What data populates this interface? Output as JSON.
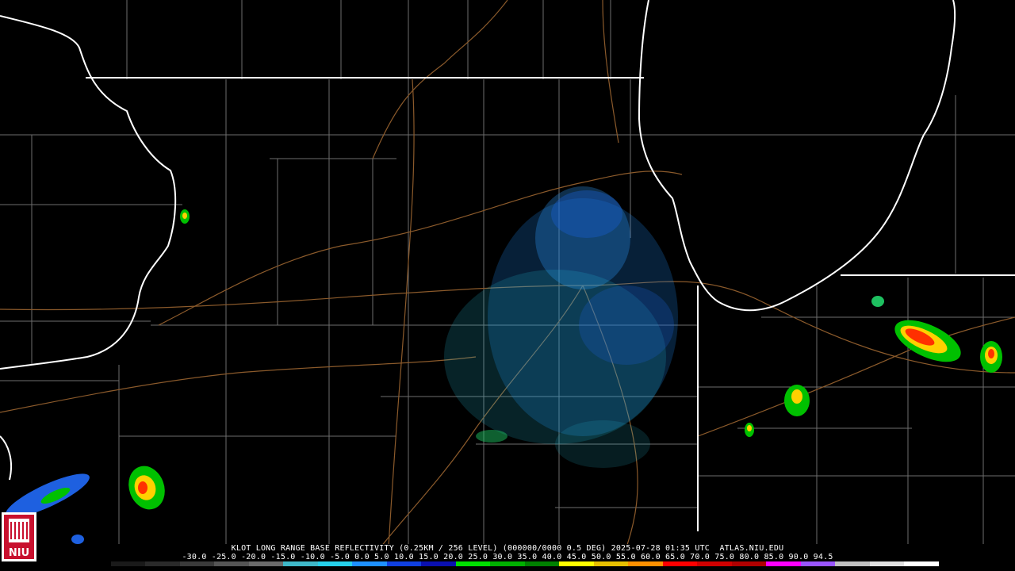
{
  "product_title": "KLOT LONG RANGE BASE REFLECTIVITY (0.25KM / 256 LEVEL) (000000/0000 0.5 DEG) 2025-07-28 01:35 UTC  ATLAS.NIU.EDU",
  "colorbar": {
    "tick_labels": [
      "-30.0",
      "-25.0",
      "-20.0",
      "-15.0",
      "-10.0",
      "-5.0",
      "0.0",
      "5.0",
      "10.0",
      "15.0",
      "20.0",
      "25.0",
      "30.0",
      "35.0",
      "40.0",
      "45.0",
      "50.0",
      "55.0",
      "60.0",
      "65.0",
      "70.0",
      "75.0",
      "80.0",
      "85.0",
      "90.0",
      "94.5"
    ],
    "colors": [
      "#000000",
      "#1a1a1a",
      "#2a2a2a",
      "#3a3a3a",
      "#555555",
      "#6a6a6a",
      "#3fb8c8",
      "#25d0ea",
      "#1e90ff",
      "#1040e0",
      "#0a10b0",
      "#00e000",
      "#00b000",
      "#008000",
      "#ffff00",
      "#e8c000",
      "#ff9000",
      "#ff0000",
      "#d00000",
      "#b00000",
      "#ff00ff",
      "#9955ff",
      "#c0c0c0",
      "#e0e0e0",
      "#ffffff"
    ]
  },
  "logo": {
    "text": "NIU"
  },
  "map_colors": {
    "background": "#000000",
    "state_border": "#ffffff",
    "county_line": "#7a7a7a",
    "highway": "#8b5a2b",
    "lake_shore": "#ffffff"
  }
}
